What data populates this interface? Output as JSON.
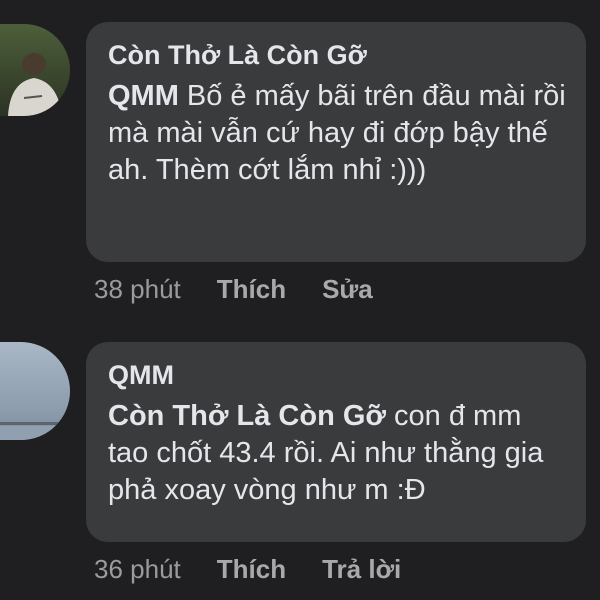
{
  "comments": [
    {
      "author": "Còn Thở Là Còn Gỡ",
      "mention": "QMM",
      "text": "Bố ẻ mấy bãi trên đầu mài rồi mà mài vẫn cứ hay đi đớp bậy thế ah. Thèm cớt lắm nhỉ :)))",
      "time": "38 phút",
      "actions": [
        "Thích",
        "Sửa"
      ]
    },
    {
      "author": "QMM",
      "mention": "Còn Thở Là Còn Gỡ",
      "text": "con đ mm tao chốt 43.4 rồi. Ai như thằng gia phả xoay vòng như m :Đ",
      "time": "36 phút",
      "actions": [
        "Thích",
        "Trả lời"
      ]
    }
  ]
}
